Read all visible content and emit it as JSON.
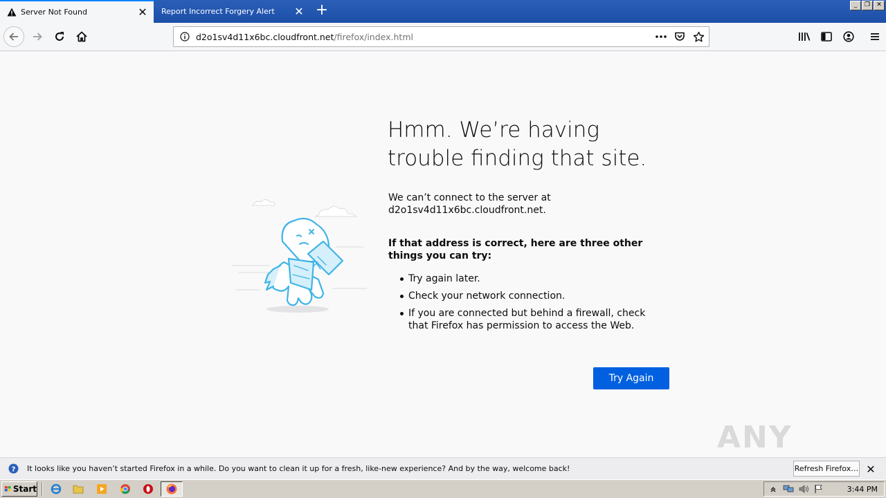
{
  "tabs": [
    {
      "label": "Server Not Found",
      "active": true,
      "icon": "warning-icon"
    },
    {
      "label": "Report Incorrect Forgery Alert",
      "active": false
    }
  ],
  "window_controls": {
    "minimize": "_",
    "restore": "❐",
    "close": "✕"
  },
  "navbar": {
    "url_host": "d2o1sv4d11x6bc.cloudfront.net",
    "url_path": "/firefox/index.html"
  },
  "error_page": {
    "title": "Hmm. We’re having trouble finding that site.",
    "description": "We can’t connect to the server at d2o1sv4d11x6bc.cloudfront.net.",
    "subtitle": "If that address is correct, here are three other things you can try:",
    "suggestions": [
      "Try again later.",
      "Check your network connection.",
      "If you are connected but behind a firewall, check that Firefox has permission to access the Web."
    ],
    "try_again_label": "Try Again"
  },
  "watermark": {
    "text": "ANY RUN"
  },
  "notification": {
    "text": "It looks like you haven’t started Firefox in a while. Do you want to clean it up for a fresh, like-new experience? And by the way, welcome back!",
    "refresh_label": "Refresh Firefox…"
  },
  "taskbar": {
    "start_label": "Start",
    "clock": "3:44 PM"
  },
  "colors": {
    "accent": "#0060df",
    "tabbar": "#1d4fa8",
    "page_bg": "#f9f9fa",
    "illustration": "#3fb4e6"
  }
}
